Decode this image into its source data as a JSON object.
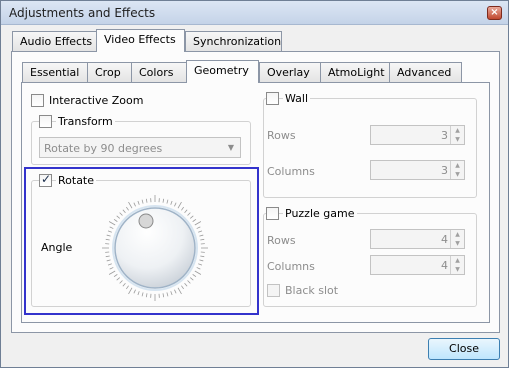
{
  "window": {
    "title": "Adjustments and Effects",
    "close_glyph": "×"
  },
  "main_tabs": [
    "Audio Effects",
    "Video Effects",
    "Synchronization"
  ],
  "sub_tabs": [
    "Essential",
    "Crop",
    "Colors",
    "Geometry",
    "Overlay",
    "AtmoLight",
    "Advanced"
  ],
  "geometry": {
    "interactive_zoom": {
      "label": "Interactive Zoom",
      "checked": false
    },
    "transform": {
      "label": "Transform",
      "checked": false,
      "select_value": "Rotate by 90 degrees"
    },
    "rotate": {
      "label": "Rotate",
      "checked": true,
      "angle_label": "Angle"
    },
    "wall": {
      "label": "Wall",
      "checked": false,
      "rows_label": "Rows",
      "rows_value": "3",
      "columns_label": "Columns",
      "columns_value": "3"
    },
    "puzzle": {
      "label": "Puzzle game",
      "checked": false,
      "rows_label": "Rows",
      "rows_value": "4",
      "columns_label": "Columns",
      "columns_value": "4",
      "black_slot_label": "Black slot",
      "black_slot_checked": false
    }
  },
  "footer": {
    "close_label": "Close"
  },
  "colors": {
    "focus": "#3333cc",
    "disabled_text": "#8d8d8d"
  }
}
